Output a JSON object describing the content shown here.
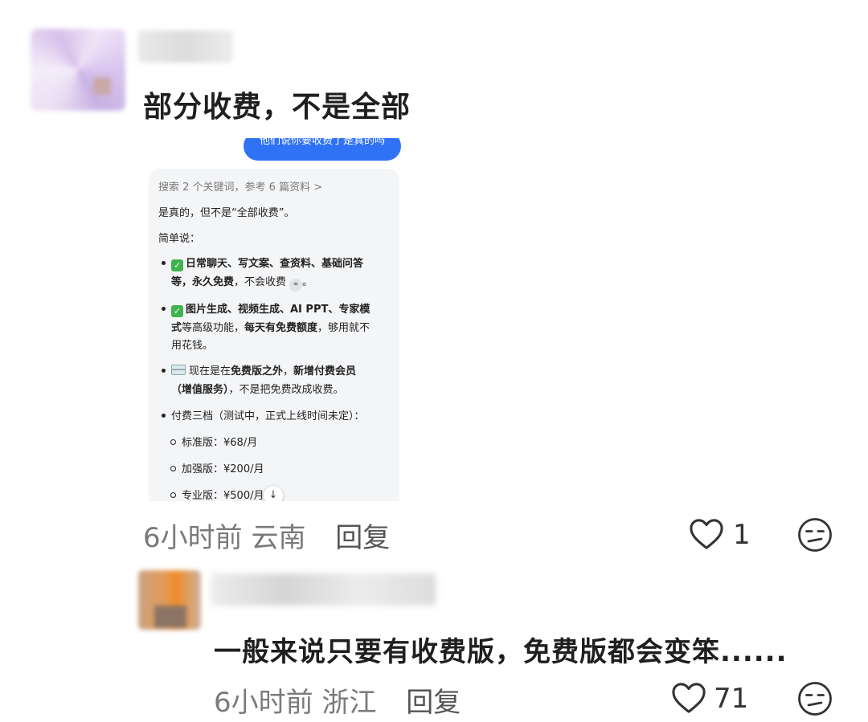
{
  "comment1": {
    "text": "部分收费，不是全部",
    "time": "6小时前",
    "location": "云南",
    "reply_label": "回复",
    "likes": "1"
  },
  "screenshot": {
    "bubble_text": "他们说你要收费了是真的吗",
    "search_line": "搜索 2 个关键词，参考 6 篇资料 >",
    "line1": "是真的，但不是“全部收费”。",
    "brief": "简单说：",
    "b1a_bold": "日常聊天、写文案、查资料、基础问答",
    "b1b_bold": "等，永久免费",
    "b1b_rest": "，不会收费",
    "b1b_end": "。",
    "b2a_bold": "图片生成、视频生成、AI PPT、专家模",
    "b2b_start": "式",
    "b2b_mid": "等高级功能，",
    "b2b_bold": "每天有免费额度",
    "b2b_rest": "，够用就不",
    "b2c": "用花钱。",
    "b3a_prefix": "现在是在",
    "b3a_bold1": "免费版之外",
    "b3a_mid": "，",
    "b3a_bold2": "新增付费会员",
    "b3b_bold": "（增值服务）",
    "b3b_rest": "，不是把免费改成收费。",
    "b4": "付费三档（测试中，正式上线时间未定）：",
    "tier1": "标准版：¥68/月",
    "tier2": "加强版：¥200/月",
    "tier3": "专业版：¥500/月"
  },
  "comment2": {
    "text": "一般来说只要有收费版，免费版都会变笨......",
    "time": "6小时前",
    "location": "浙江",
    "reply_label": "回复",
    "likes": "71"
  },
  "icons": [
    "heart-icon",
    "meh-face-icon",
    "check-icon",
    "card-icon",
    "link-icon",
    "down-arrow-icon"
  ]
}
